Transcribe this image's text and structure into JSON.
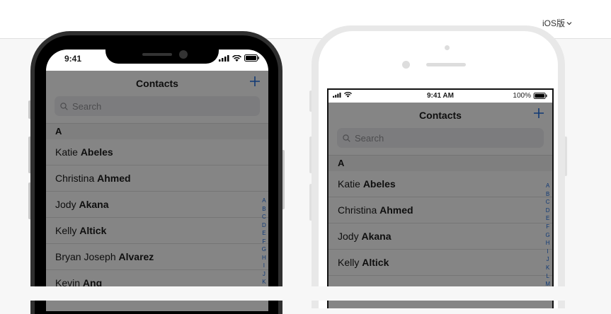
{
  "header": {
    "version_label": "iOS版"
  },
  "phone_x": {
    "status": {
      "time": "9:41"
    },
    "nav": {
      "title": "Contacts"
    },
    "search": {
      "placeholder": "Search"
    },
    "section": "A",
    "contacts": [
      {
        "first": "Katie ",
        "last": "Abeles"
      },
      {
        "first": "Christina ",
        "last": "Ahmed"
      },
      {
        "first": "Jody ",
        "last": "Akana"
      },
      {
        "first": "Kelly ",
        "last": "Altick"
      },
      {
        "first": "Bryan Joseph ",
        "last": "Alvarez"
      },
      {
        "first": "Kevin ",
        "last": "Ang"
      }
    ],
    "index": [
      "A",
      "B",
      "C",
      "D",
      "E",
      "F",
      "G",
      "H",
      "I",
      "J",
      "K"
    ]
  },
  "phone_8": {
    "status": {
      "time": "9:41 AM",
      "battery": "100%"
    },
    "nav": {
      "title": "Contacts"
    },
    "search": {
      "placeholder": "Search"
    },
    "section": "A",
    "contacts": [
      {
        "first": "Katie ",
        "last": "Abeles"
      },
      {
        "first": "Christina ",
        "last": "Ahmed"
      },
      {
        "first": "Jody ",
        "last": "Akana"
      },
      {
        "first": "Kelly ",
        "last": "Altick"
      }
    ],
    "index": [
      "A",
      "B",
      "C",
      "D",
      "E",
      "F",
      "G",
      "H",
      "I",
      "J",
      "K",
      "L",
      "M"
    ]
  },
  "colors": {
    "accent": "#1e6ad8",
    "overlay": "rgba(0,0,0,0.46)"
  },
  "icons": [
    "chevron-down-icon",
    "plus-icon",
    "search-icon",
    "signal-icon",
    "wifi-icon",
    "battery-icon"
  ]
}
